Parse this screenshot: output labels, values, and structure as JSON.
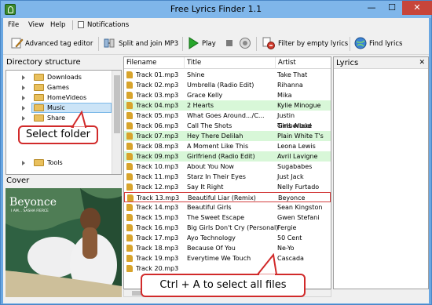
{
  "window": {
    "title": "Free Lyrics Finder 1.1",
    "min": "—",
    "max": "☐",
    "close": "✕"
  },
  "menu": {
    "file": "File",
    "view": "View",
    "help": "Help",
    "notifications": "Notifications"
  },
  "toolbar": {
    "adv_tag_editor": "Advanced tag editor",
    "split_join": "Split and join MP3",
    "play": "Play",
    "filter_empty": "Filter by empty lyrics",
    "find_lyrics": "Find lyrics"
  },
  "directory": {
    "header": "Directory structure",
    "items": [
      {
        "label": "Downloads",
        "selected": false
      },
      {
        "label": "Games",
        "selected": false
      },
      {
        "label": "HomeVideos",
        "selected": false
      },
      {
        "label": "Music",
        "selected": true
      },
      {
        "label": "Share",
        "selected": false
      },
      {
        "label": "Tools",
        "selected": false
      }
    ]
  },
  "cover": {
    "header": "Cover",
    "art_text": "Beyonce",
    "art_subtext": "I AM... SASHA FIERCE"
  },
  "tracks": {
    "columns": [
      "Filename",
      "Title",
      "Artist"
    ],
    "rows": [
      {
        "filename": "Track 01.mp3",
        "title": "Shine",
        "artist": "Take That",
        "hl": false
      },
      {
        "filename": "Track 02.mp3",
        "title": "Umbrella (Radio Edit)",
        "artist": "Rihanna",
        "hl": false
      },
      {
        "filename": "Track 03.mp3",
        "title": "Grace Kelly",
        "artist": "Mika",
        "hl": false
      },
      {
        "filename": "Track 04.mp3",
        "title": "2 Hearts",
        "artist": "Kylie Minogue",
        "hl": true
      },
      {
        "filename": "Track 05.mp3",
        "title": "What Goes Around.../C...",
        "artist": "Justin Timberlake",
        "hl": false
      },
      {
        "filename": "Track 06.mp3",
        "title": "Call The Shots",
        "artist": "Girls Aloud",
        "hl": false
      },
      {
        "filename": "Track 07.mp3",
        "title": "Hey There Delilah",
        "artist": "Plain White T's",
        "hl": true
      },
      {
        "filename": "Track 08.mp3",
        "title": "A Moment Like This",
        "artist": "Leona Lewis",
        "hl": false
      },
      {
        "filename": "Track 09.mp3",
        "title": "Girlfriend (Radio Edit)",
        "artist": "Avril Lavigne",
        "hl": true
      },
      {
        "filename": "Track 10.mp3",
        "title": "About You Now",
        "artist": "Sugababes",
        "hl": false
      },
      {
        "filename": "Track 11.mp3",
        "title": "Starz In Their Eyes",
        "artist": "Just Jack",
        "hl": false
      },
      {
        "filename": "Track 12.mp3",
        "title": "Say It Right",
        "artist": "Nelly Furtado",
        "hl": false
      },
      {
        "filename": "Track 13.mp3",
        "title": "Beautiful Liar (Remix)",
        "artist": "Beyonce",
        "hl": false,
        "selected": true
      },
      {
        "filename": "Track 14.mp3",
        "title": "Beautiful Girls",
        "artist": "Sean Kingston",
        "hl": false
      },
      {
        "filename": "Track 15.mp3",
        "title": "The Sweet Escape",
        "artist": "Gwen Stefani",
        "hl": false
      },
      {
        "filename": "Track 16.mp3",
        "title": "Big Girls Don't Cry (Personal)",
        "artist": "Fergie",
        "hl": false
      },
      {
        "filename": "Track 17.mp3",
        "title": "Ayo Technology",
        "artist": "50 Cent",
        "hl": false
      },
      {
        "filename": "Track 18.mp3",
        "title": "Because Of You",
        "artist": "Ne-Yo",
        "hl": false
      },
      {
        "filename": "Track 19.mp3",
        "title": "Everytime We Touch",
        "artist": "Cascada",
        "hl": false
      },
      {
        "filename": "Track 20.mp3",
        "title": "",
        "artist": "",
        "hl": false
      }
    ]
  },
  "lyrics": {
    "header": "Lyrics",
    "close": "✕"
  },
  "callouts": {
    "select_folder": "Select folder",
    "select_all": "Ctrl + A to select all files"
  },
  "colors": {
    "title_bar": "#7fb6ea",
    "highlight_row": "#d8f7d8",
    "callout_border": "#d12a2a",
    "close_button": "#c7453a"
  }
}
